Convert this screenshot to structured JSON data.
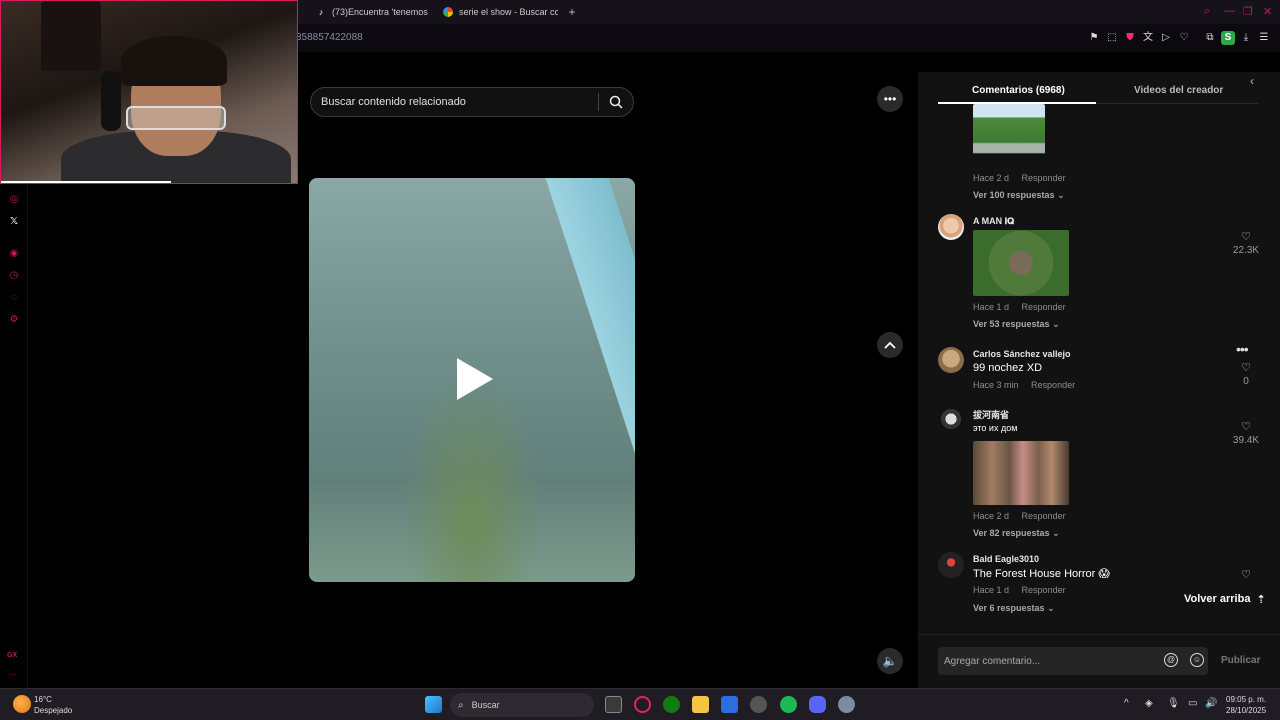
{
  "browser": {
    "tabs": [
      {
        "label": "(73)Encuentra 'tenemos u",
        "icon": "tiktok-icon"
      },
      {
        "label": "serie el show - Buscar co",
        "icon": "google-icon"
      }
    ],
    "url_fragment": "358857422088"
  },
  "search": {
    "placeholder": "Buscar contenido relacionado"
  },
  "comments_panel": {
    "tab_comments": "Comentarios (6968)",
    "tab_creator_videos": "Videos del creador",
    "comments": [
      {
        "meta_time": "Hace 2 d",
        "reply_label": "Responder",
        "more_replies": "Ver 100 respuestas"
      },
      {
        "username": "A MAN 𝐢𝐐",
        "meta_time": "Hace 1 d",
        "reply_label": "Responder",
        "more_replies": "Ver 53 respuestas",
        "likes": "22.3K"
      },
      {
        "username": "Carlos Sánchez vallejo",
        "text": "99 nochez XD",
        "meta_time": "Hace 3 min",
        "reply_label": "Responder",
        "likes": "0"
      },
      {
        "username": "拔河南省",
        "text": "это их дом",
        "meta_time": "Hace 2 d",
        "reply_label": "Responder",
        "more_replies": "Ver 82 respuestas",
        "likes": "39.4K"
      },
      {
        "username": "Bald Eagle3010",
        "text": "The Forest House Horror 😱",
        "meta_time": "Hace 1 d",
        "reply_label": "Responder",
        "more_replies": "Ver 6 respuestas"
      }
    ],
    "back_to_top": "Volver arriba",
    "composer_placeholder": "Agregar comentario...",
    "publish_label": "Publicar"
  },
  "taskbar": {
    "weather_temp": "16°C",
    "weather_desc": "Despejado",
    "search_label": "Buscar",
    "time": "09:05 p. m.",
    "date": "28/10/2025"
  },
  "colors": {
    "opera_accent": "#c2185b",
    "panel_bg": "#121212",
    "page_bg": "#000000"
  }
}
